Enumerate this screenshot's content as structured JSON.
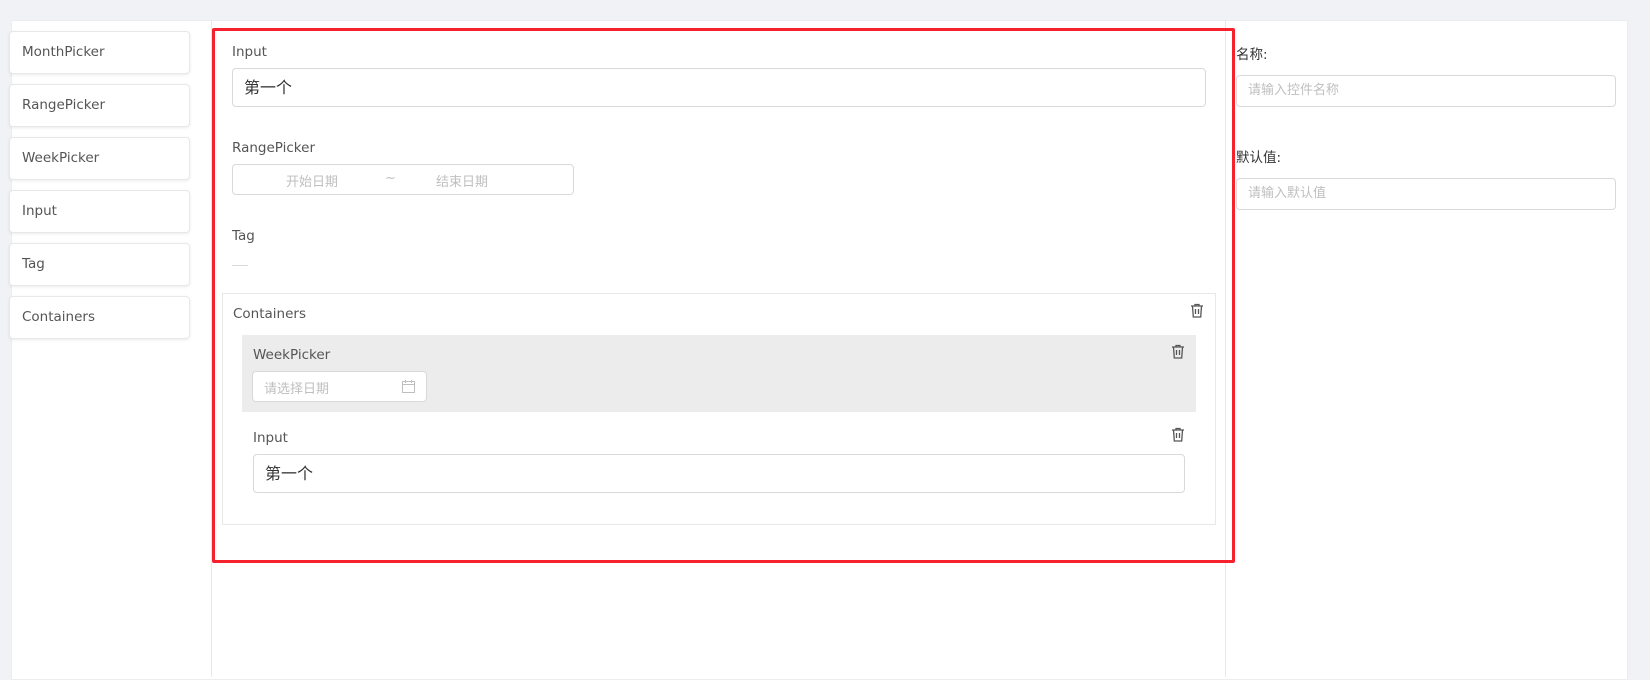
{
  "palette": {
    "items": [
      "MonthPicker",
      "RangePicker",
      "WeekPicker",
      "Input",
      "Tag",
      "Containers"
    ]
  },
  "canvas": {
    "input_field": {
      "label": "Input",
      "value": "第一个"
    },
    "range_picker": {
      "label": "RangePicker",
      "start_placeholder": "开始日期",
      "separator": "~",
      "end_placeholder": "结束日期"
    },
    "tag_field": {
      "label": "Tag"
    },
    "container": {
      "label": "Containers",
      "week_picker": {
        "label": "WeekPicker",
        "placeholder": "请选择日期"
      },
      "inner_input": {
        "label": "Input",
        "value": "第一个"
      }
    }
  },
  "properties": {
    "name_label": "名称:",
    "name_placeholder": "请输入控件名称",
    "default_label": "默认值:",
    "default_placeholder": "请输入默认值"
  },
  "colors": {
    "highlight": "#f5222d",
    "selected_block": "#ececec"
  },
  "icons": [
    "trash-icon",
    "calendar-icon"
  ]
}
